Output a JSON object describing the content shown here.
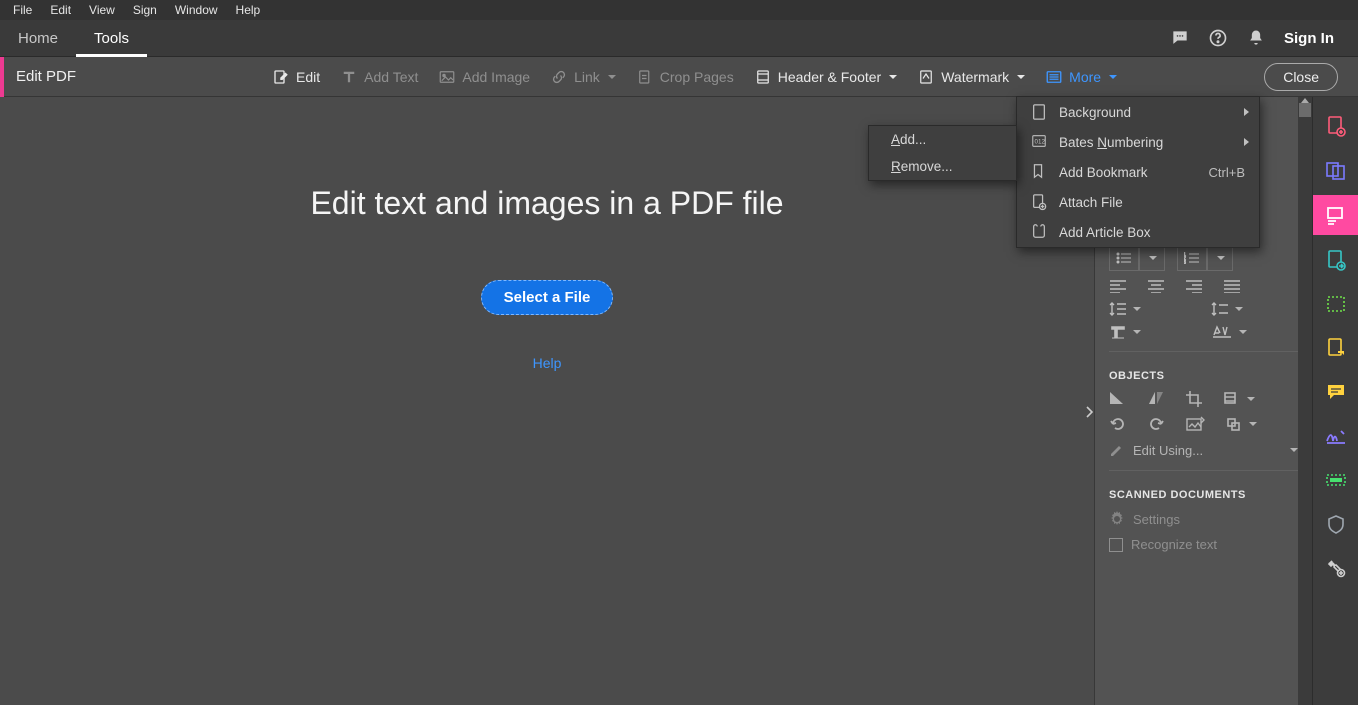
{
  "menubar": [
    "File",
    "Edit",
    "View",
    "Sign",
    "Window",
    "Help"
  ],
  "tabs": {
    "home": "Home",
    "tools": "Tools"
  },
  "signin": "Sign In",
  "toolbar": {
    "title": "Edit PDF",
    "edit": "Edit",
    "addtext": "Add Text",
    "addimage": "Add Image",
    "link": "Link",
    "crop": "Crop Pages",
    "headerfooter": "Header & Footer",
    "watermark": "Watermark",
    "more": "More",
    "close": "Close"
  },
  "main": {
    "heading": "Edit text and images in a PDF file",
    "selectfile": "Select a File",
    "help": "Help"
  },
  "more_menu": {
    "background": "Background",
    "bates": "Bates Numbering",
    "bookmark": "Add Bookmark",
    "bookmark_sc": "Ctrl+B",
    "attach": "Attach File",
    "article": "Add Article Box"
  },
  "bates_sub": {
    "add": "Add...",
    "remove": "Remove..."
  },
  "rpanel": {
    "objects": "OBJECTS",
    "editusing": "Edit Using...",
    "scanned": "SCANNED DOCUMENTS",
    "settings": "Settings",
    "recognize": "Recognize text"
  }
}
